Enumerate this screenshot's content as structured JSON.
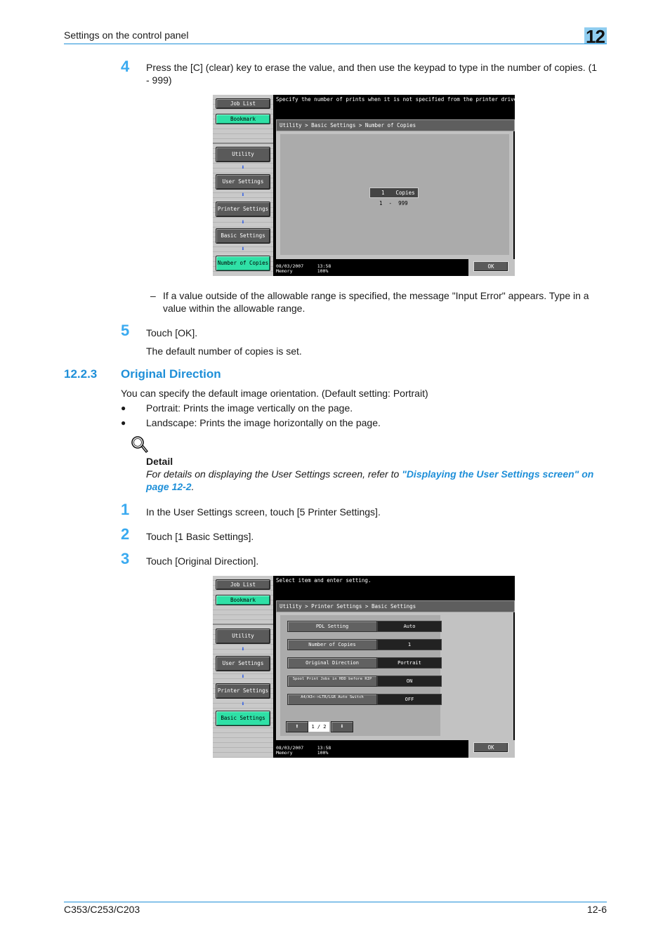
{
  "header": {
    "title": "Settings on the control panel",
    "chapter": "12"
  },
  "step4": {
    "num": "4",
    "text": "Press the [C] (clear) key to erase the value, and then use the keypad to type in the number of copies. (1",
    "text2": "- 999)"
  },
  "screen1": {
    "left_panel": {
      "job_list": "Job List",
      "bookmark": "Bookmark",
      "nav": [
        "Utility",
        "User Settings",
        "Printer Settings",
        "Basic Settings",
        "Number of Copies"
      ]
    },
    "message": "Specify the number of prints when it is not specified from the printer driver.",
    "breadcrumb": "Utility > Basic Settings > Number of Copies",
    "copies_value": "1",
    "copies_unit": "Copies",
    "range": "1  -  999",
    "status_date": "08/03/2007",
    "status_time": "13:58",
    "status_memory_label": "Memory",
    "status_memory_value": "100%",
    "ok": "OK"
  },
  "note": {
    "dash": "–",
    "text": "If a value outside of the allowable range is specified, the message \"Input Error\" appears. Type in a",
    "text2": "value within the allowable range."
  },
  "step5": {
    "num": "5",
    "text": "Touch [OK].",
    "result": "The default number of copies is set."
  },
  "section": {
    "number": "12.2.3",
    "title": "Original Direction",
    "intro": "You can specify the default image orientation. (Default setting: Portrait)",
    "bullets": [
      "Portrait: Prints the image vertically on the page.",
      "Landscape: Prints the image horizontally on the page."
    ],
    "bullet_char": "●"
  },
  "detail": {
    "label": "Detail",
    "text_before": "For details on displaying the User Settings screen, refer to ",
    "link": "\"Displaying the User Settings screen\" on page 12-2",
    "text_after": "."
  },
  "steps": [
    {
      "num": "1",
      "text": "In the User Settings screen, touch [5 Printer Settings]."
    },
    {
      "num": "2",
      "text": "Touch [1 Basic Settings]."
    },
    {
      "num": "3",
      "text": "Touch [Original Direction]."
    }
  ],
  "screen2": {
    "left_panel": {
      "job_list": "Job List",
      "bookmark": "Bookmark",
      "nav": [
        "Utility",
        "User Settings",
        "Printer Settings",
        "Basic Settings"
      ]
    },
    "message": "Select item and enter setting.",
    "breadcrumb": "Utility > Printer Settings > Basic Settings",
    "settings": [
      {
        "label": "PDL Setting",
        "value": "Auto"
      },
      {
        "label": "Number of Copies",
        "value": "1"
      },
      {
        "label": "Original Direction",
        "value": "Portrait"
      },
      {
        "label": "Spool Print Jobs in HDD before RIP",
        "value": "ON"
      },
      {
        "label": "A4/A3<->LTR/LGR Auto Switch",
        "value": "OFF"
      }
    ],
    "page_indicator": "1 / 2",
    "status_date": "08/03/2007",
    "status_time": "13:58",
    "status_memory_label": "Memory",
    "status_memory_value": "100%",
    "ok": "OK"
  },
  "footer": {
    "model": "C353/C253/C203",
    "page": "12-6"
  }
}
